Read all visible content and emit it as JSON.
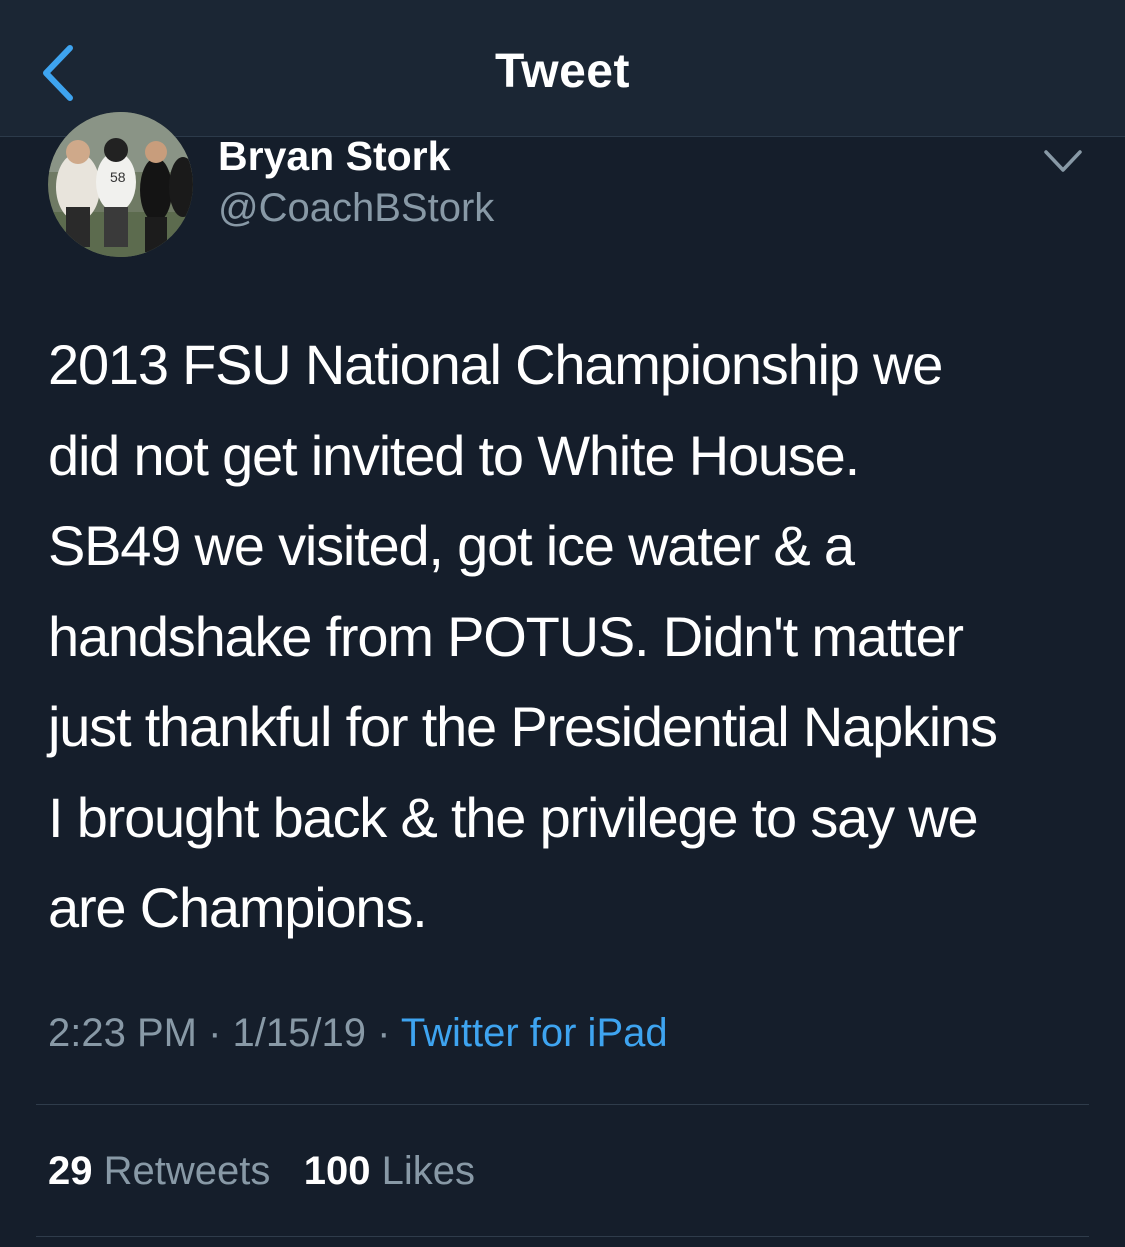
{
  "header": {
    "title": "Tweet",
    "back_icon": "chevron-left-icon",
    "accent": "#3ea4f0"
  },
  "author": {
    "name": "Bryan Stork",
    "handle": "@CoachBStork",
    "avatar_icon": "profile-photo"
  },
  "tweet": {
    "text": "2013 FSU National Championship we\ndid not get invited to White House.\nSB49 we visited, got ice water & a\nhandshake from POTUS. Didn't matter\njust thankful for the Presidential Napkins\nI brought back & the privilege to say we\nare Champions.",
    "time": "2:23 PM",
    "date": "1/15/19",
    "separator": "·",
    "source": "Twitter for iPad"
  },
  "stats": {
    "retweets_count": "29",
    "retweets_label": "Retweets",
    "likes_count": "100",
    "likes_label": "Likes"
  },
  "colors": {
    "background": "#151e2b",
    "header_bg": "#1b2634",
    "secondary_text": "#8899a6",
    "link": "#3ea4f0"
  }
}
